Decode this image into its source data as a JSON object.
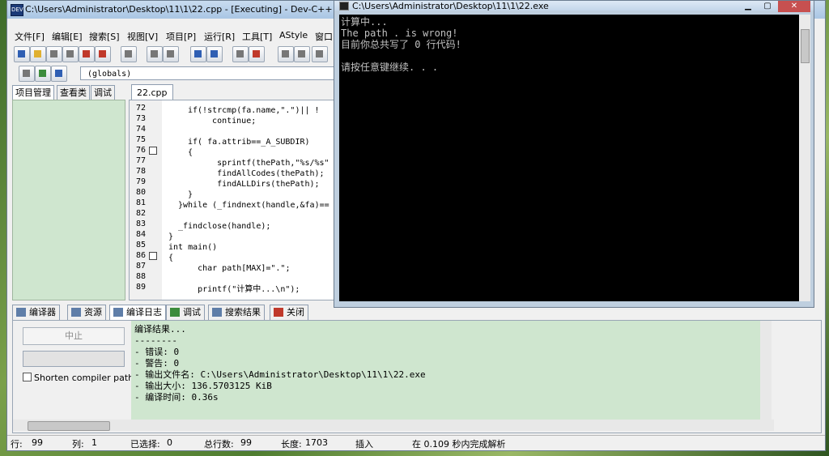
{
  "ide": {
    "title": "C:\\Users\\Administrator\\Desktop\\11\\1\\22.cpp - [Executing] - Dev-C++ 5.11",
    "menu": [
      "文件[F]",
      "编辑[E]",
      "搜索[S]",
      "视图[V]",
      "项目[P]",
      "运行[R]",
      "工具[T]",
      "AStyle",
      "窗口"
    ],
    "scope_selector": "(globals)",
    "left_tabs": [
      "项目管理",
      "查看类",
      "调试"
    ],
    "editor_tab": "22.cpp",
    "code_lines": [
      {
        "n": "72",
        "text": "if(!strcmp(fa.name,\".\")|| !"
      },
      {
        "n": "73",
        "text": "   continue;"
      },
      {
        "n": "74",
        "text": ""
      },
      {
        "n": "75",
        "text": "if( fa.attrib==_A_SUBDIR)"
      },
      {
        "n": "76",
        "text": "{"
      },
      {
        "n": "77",
        "text": "    sprintf(thePath,\"%s/%s\""
      },
      {
        "n": "78",
        "text": "    findAllCodes(thePath);"
      },
      {
        "n": "79",
        "text": "    findALLDirs(thePath);"
      },
      {
        "n": "80",
        "text": "}"
      },
      {
        "n": "81",
        "text": "}while (_findnext(handle,&fa)=="
      },
      {
        "n": "82",
        "text": ""
      },
      {
        "n": "83",
        "text": "_findclose(handle);"
      },
      {
        "n": "84",
        "text": "}"
      },
      {
        "n": "85",
        "text": "int main()"
      },
      {
        "n": "86",
        "text": "{"
      },
      {
        "n": "87",
        "text": "    char path[MAX]=\".\";"
      },
      {
        "n": "88",
        "text": ""
      },
      {
        "n": "89",
        "text": "    printf(\"计算中...\\n\");"
      }
    ],
    "bottom_tabs": [
      "编译器",
      "资源",
      "编译日志",
      "调试",
      "搜索结果",
      "关闭"
    ],
    "stop_button": "中止",
    "shorten_label": "Shorten compiler paths",
    "log_lines": [
      "编译结果...",
      "--------",
      "- 错误: 0",
      "- 警告: 0",
      "- 输出文件名: C:\\Users\\Administrator\\Desktop\\11\\1\\22.exe",
      "- 输出大小: 136.5703125 KiB",
      "- 编译时间: 0.36s"
    ],
    "status": {
      "row_label": "行:",
      "row": "99",
      "col_label": "列:",
      "col": "1",
      "sel_label": "已选择:",
      "sel": "0",
      "lines_label": "总行数:",
      "lines": "99",
      "len_label": "长度:",
      "len": "1703",
      "mode": "插入",
      "parse": "在 0.109 秒内完成解析"
    }
  },
  "console": {
    "title": "C:\\Users\\Administrator\\Desktop\\11\\1\\22.exe",
    "close_glyph": "✕",
    "lines": [
      "计算中...",
      "The path . is wrong!",
      "目前你总共写了 0 行代码!",
      "",
      "请按任意键继续. . ."
    ]
  }
}
